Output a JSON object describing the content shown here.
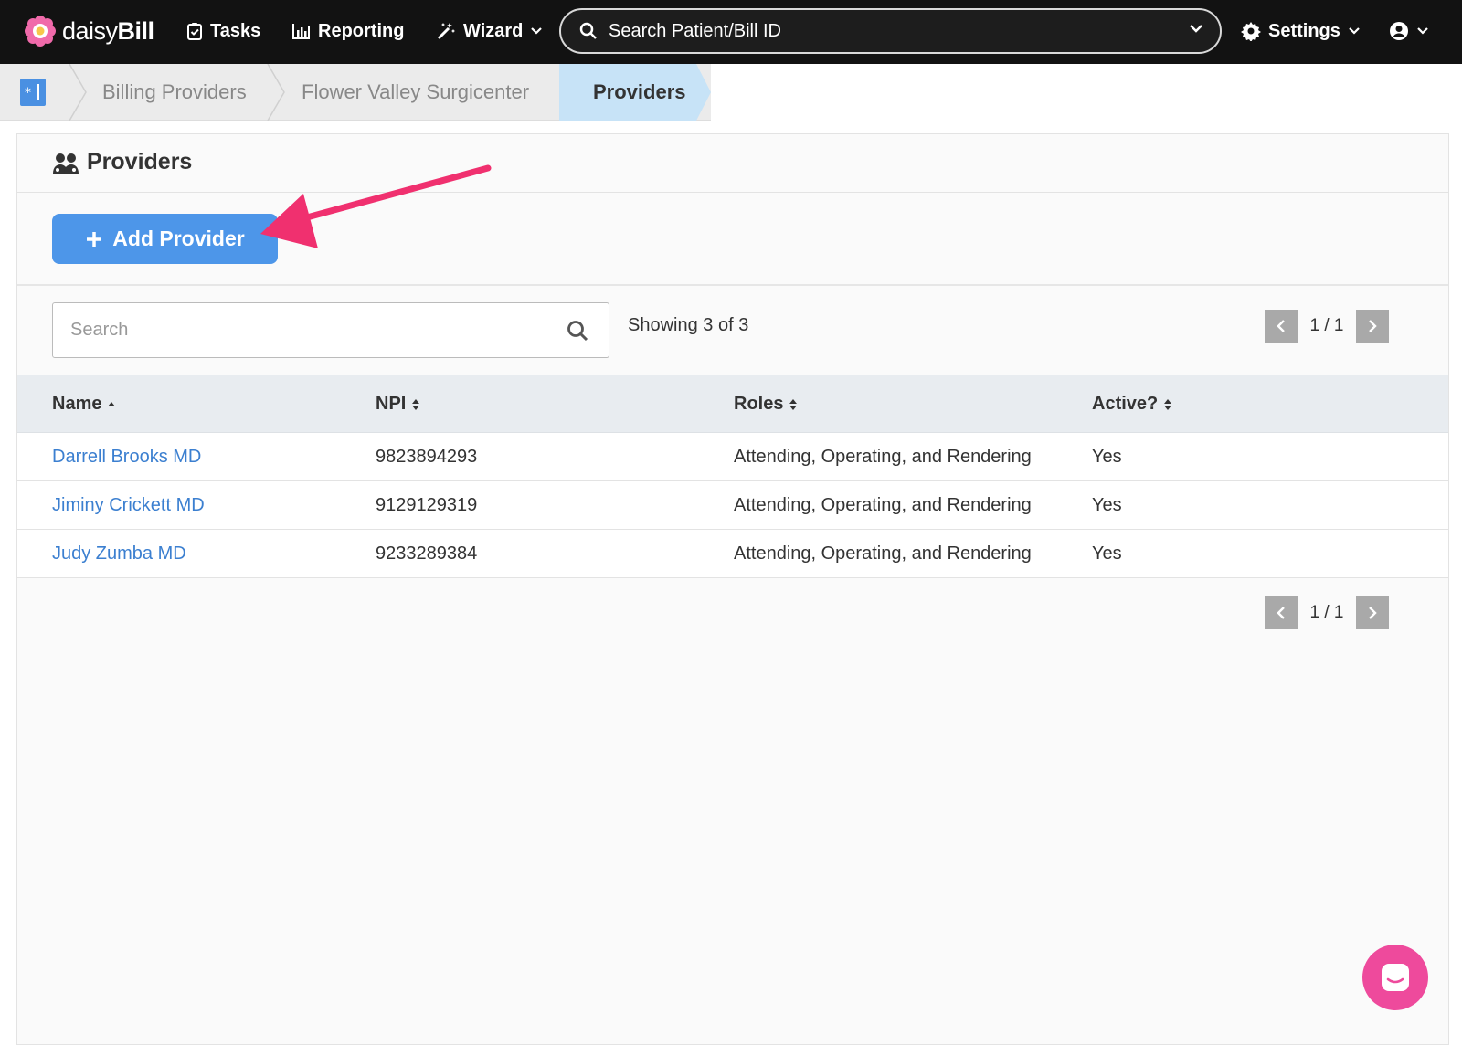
{
  "navbar": {
    "brand_light": "daisy",
    "brand_bold": "Bill",
    "tasks": "Tasks",
    "reporting": "Reporting",
    "wizard": "Wizard",
    "search_placeholder": "Search Patient/Bill ID",
    "settings": "Settings"
  },
  "breadcrumb": {
    "items": [
      "Billing Providers",
      "Flower Valley Surgicenter",
      "Providers"
    ]
  },
  "panel": {
    "title": "Providers",
    "add_button": "Add Provider",
    "search_placeholder": "Search",
    "showing": "Showing 3 of 3",
    "pager_top": "1 / 1",
    "pager_bottom": "1 / 1"
  },
  "table": {
    "columns": [
      "Name",
      "NPI",
      "Roles",
      "Active?"
    ],
    "rows": [
      {
        "name": "Darrell Brooks MD",
        "npi": "9823894293",
        "roles": "Attending, Operating, and Rendering",
        "active": "Yes"
      },
      {
        "name": "Jiminy Crickett MD",
        "npi": "9129129319",
        "roles": "Attending, Operating, and Rendering",
        "active": "Yes"
      },
      {
        "name": "Judy Zumba MD",
        "npi": "9233289384",
        "roles": "Attending, Operating, and Rendering",
        "active": "Yes"
      }
    ]
  },
  "colors": {
    "accent": "#4d96e9",
    "link": "#3b7fd0",
    "annotation": "#f0306f",
    "chat": "#ee4a9c"
  }
}
